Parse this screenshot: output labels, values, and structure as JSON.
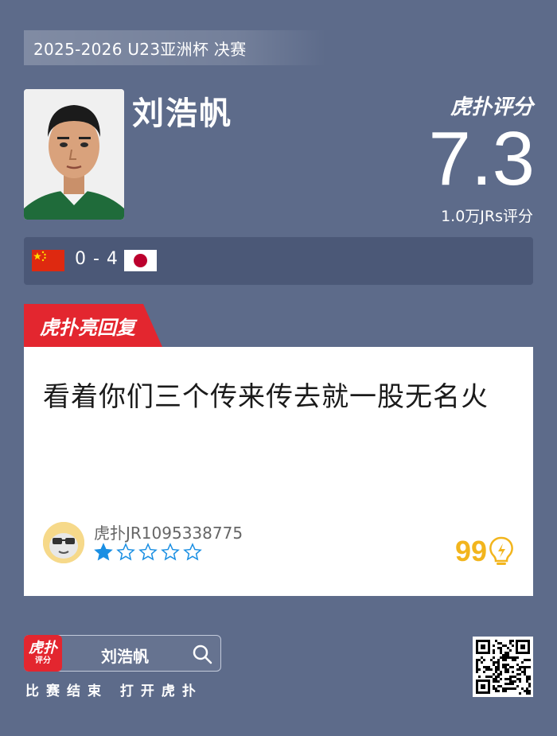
{
  "header": {
    "event_title": "2025-2026 U23亚洲杯 决赛"
  },
  "player": {
    "name": "刘浩帆"
  },
  "rating": {
    "brand": "虎扑评分",
    "score": "7.3",
    "count_text": "1.0万JRs评分"
  },
  "match": {
    "home_flag": "china-flag",
    "away_flag": "japan-flag",
    "score": "0 - 4"
  },
  "highlight": {
    "tag_label": "虎扑亮回复"
  },
  "comment": {
    "text": "看着你们三个传来传去就一股无名火",
    "username": "虎扑JR1095338775",
    "stars_total": 5,
    "stars_filled": 1,
    "likes": "99",
    "like_icon": "lightbulb-icon"
  },
  "footer": {
    "app_logo_line1": "虎扑",
    "app_logo_line2": "评分",
    "search_text": "刘浩帆",
    "cta_text": "比赛结束 打开虎扑"
  },
  "colors": {
    "background": "#5d6b8a",
    "accent_red": "#e3262f",
    "like_yellow": "#f2b51d",
    "star_blue": "#1a8fe3"
  }
}
